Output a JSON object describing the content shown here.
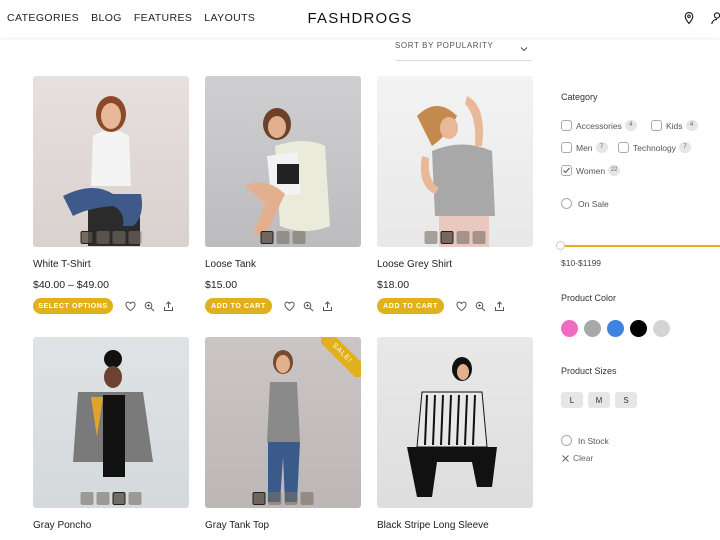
{
  "header": {
    "nav": [
      "CATEGORIES",
      "BLOG",
      "FEATURES",
      "LAYOUTS"
    ],
    "logo": "FASHDROGS",
    "icons": [
      "location-pin-icon",
      "user-icon"
    ]
  },
  "sort": {
    "label": "SORT BY POPULARITY"
  },
  "products": [
    {
      "name": "White T-Shirt",
      "price": "$40.00 – $49.00",
      "button": "SELECT OPTIONS",
      "thumbs": 4,
      "selected": 0,
      "sale": false
    },
    {
      "name": "Loose Tank",
      "price": "$15.00",
      "button": "ADD TO CART",
      "thumbs": 3,
      "selected": 0,
      "sale": false
    },
    {
      "name": "Loose Grey Shirt",
      "price": "$18.00",
      "button": "ADD TO CART",
      "thumbs": 4,
      "selected": 1,
      "sale": false
    },
    {
      "name": "Gray Poncho",
      "price": "",
      "button": "",
      "thumbs": 4,
      "selected": 2,
      "sale": false
    },
    {
      "name": "Gray Tank Top",
      "price": "",
      "button": "",
      "thumbs": 4,
      "selected": 0,
      "sale": true,
      "sale_label": "SALE!"
    },
    {
      "name": "Black Stripe Long Sleeve",
      "price": "",
      "button": "",
      "thumbs": 0,
      "selected": 0,
      "sale": false
    }
  ],
  "sidebar": {
    "category_title": "Category",
    "categories": [
      {
        "label": "Accessories",
        "count": "4",
        "checked": false
      },
      {
        "label": "Kids",
        "count": "4",
        "checked": false
      },
      {
        "label": "Men",
        "count": "7",
        "checked": false
      },
      {
        "label": "Technology",
        "count": "7",
        "checked": false
      },
      {
        "label": "Women",
        "count": "22",
        "checked": true
      }
    ],
    "on_sale": "On Sale",
    "price_range": "$10-$1199",
    "color_title": "Product Color",
    "colors": [
      "#f06bc0",
      "#a8a8a8",
      "#3f83e0",
      "#000000",
      "#d4d4d4"
    ],
    "size_title": "Product Sizes",
    "sizes": [
      "L",
      "M",
      "S"
    ],
    "in_stock": "In Stock",
    "clear": "Clear"
  }
}
